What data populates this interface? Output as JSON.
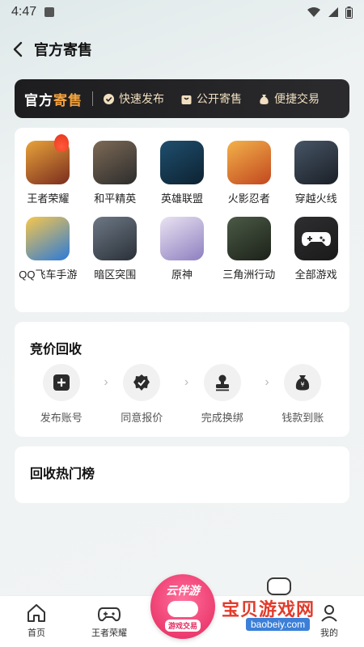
{
  "status": {
    "time": "4:47"
  },
  "header": {
    "title": "官方寄售"
  },
  "banner": {
    "brand_a": "官方",
    "brand_b": "寄售",
    "features": [
      "快速发布",
      "公开寄售",
      "便捷交易"
    ]
  },
  "games": [
    {
      "label": "王者荣耀",
      "colors": [
        "#e8a33a",
        "#7a2c1e"
      ]
    },
    {
      "label": "和平精英",
      "colors": [
        "#7d6a56",
        "#2c2c2c"
      ]
    },
    {
      "label": "英雄联盟",
      "colors": [
        "#1f4f6e",
        "#0d2231"
      ]
    },
    {
      "label": "火影忍者",
      "colors": [
        "#f3b24a",
        "#c2471f"
      ]
    },
    {
      "label": "穿越火线",
      "colors": [
        "#475566",
        "#1a1f26"
      ]
    },
    {
      "label": "QQ飞车手游",
      "colors": [
        "#f7c74c",
        "#2b7ad9"
      ]
    },
    {
      "label": "暗区突围",
      "colors": [
        "#6d7885",
        "#2a3038"
      ]
    },
    {
      "label": "原神",
      "colors": [
        "#eae3f2",
        "#8d7fc0"
      ]
    },
    {
      "label": "三角洲行动",
      "colors": [
        "#4b5a46",
        "#1c2119"
      ]
    },
    {
      "label": "全部游戏",
      "colors": [
        "#2e2e30",
        "#1a1a1b"
      ]
    }
  ],
  "recycle": {
    "title": "竞价回收",
    "steps": [
      "发布账号",
      "同意报价",
      "完成换绑",
      "钱款到账"
    ]
  },
  "hot_list": {
    "title": "回收热门榜"
  },
  "tabbar": {
    "home": "首页",
    "wzry": "王者荣耀",
    "center_top": "云伴游",
    "center_bottom": "游戏交易",
    "mine": "我的"
  },
  "watermark": {
    "text": "宝贝游戏网",
    "url": "baobeiy.com"
  }
}
